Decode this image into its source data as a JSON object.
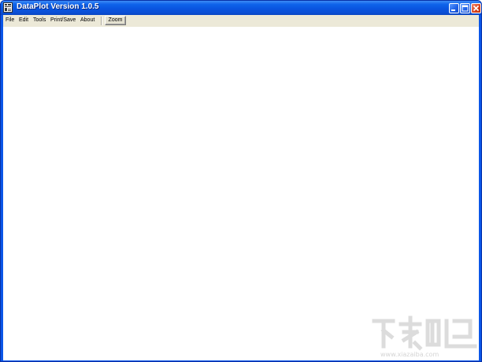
{
  "window": {
    "title": "DataPlot Version 1.0.5",
    "titlebar_color": "#0a55e0",
    "client_color": "#ffffff"
  },
  "menu": {
    "items": [
      {
        "label": "File"
      },
      {
        "label": "Edit"
      },
      {
        "label": "Tools"
      },
      {
        "label": "Print/Save"
      },
      {
        "label": "About"
      }
    ],
    "zoom_label": "Zoom"
  },
  "icons": {
    "app": "dataplot-app-icon",
    "minimize": "minimize-icon",
    "maximize": "maximize-icon",
    "close": "close-icon",
    "watermark": "xiazaiba-watermark-logo"
  },
  "watermark": {
    "text": "www.xiazaiba.com"
  }
}
